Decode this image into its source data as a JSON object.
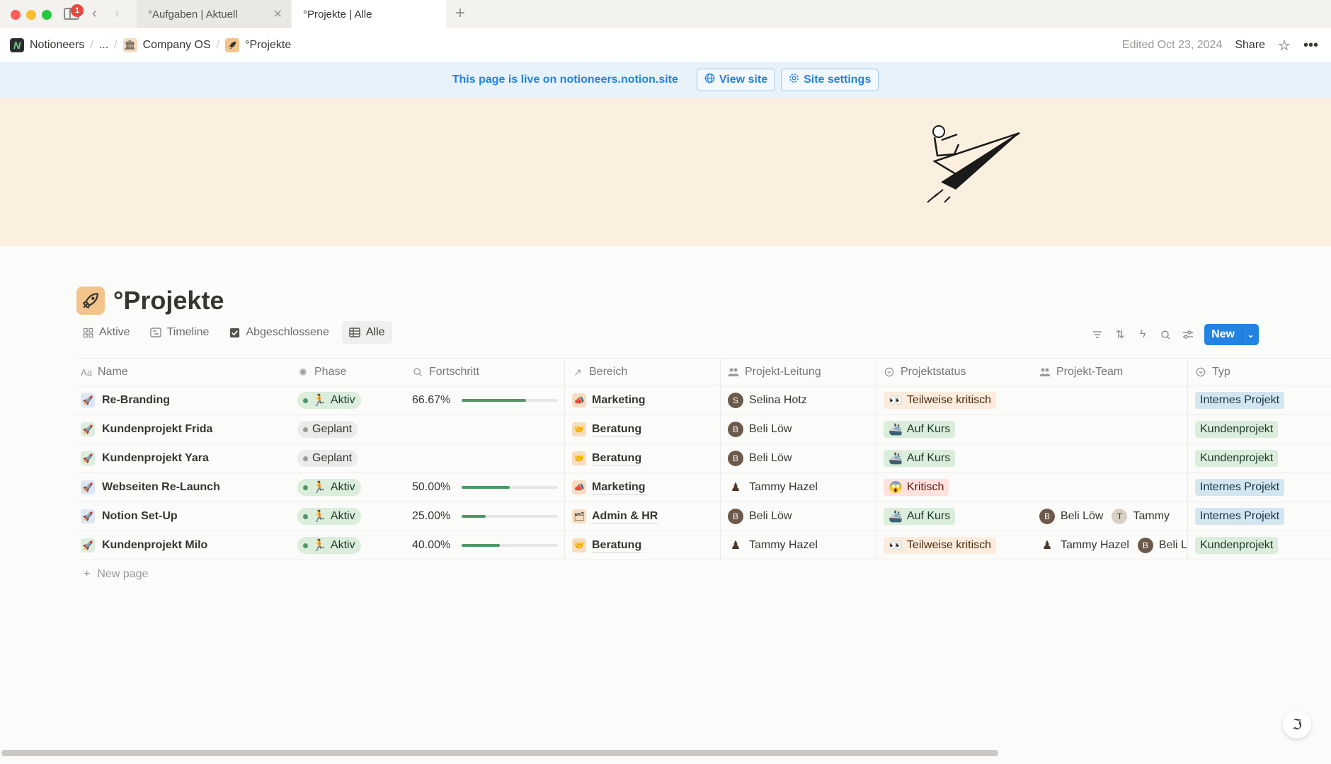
{
  "browser": {
    "notification_count": "1",
    "tabs": [
      {
        "label": "°Aufgaben | Aktuell"
      },
      {
        "label": "°Projekte | Alle"
      }
    ],
    "new_tab_label": "+"
  },
  "topbar": {
    "workspace": "Notioneers",
    "ellipsis": "...",
    "crumb_company": "Company OS",
    "crumb_projects": "°Projekte",
    "edited": "Edited Oct 23, 2024",
    "share": "Share"
  },
  "banner": {
    "text": "This page is live on notioneers.notion.site",
    "view_site": "View site",
    "site_settings": "Site settings"
  },
  "page": {
    "title": "°Projekte",
    "views": [
      {
        "label": "Aktive",
        "icon": "grid-icon"
      },
      {
        "label": "Timeline",
        "icon": "timeline-icon"
      },
      {
        "label": "Abgeschlossene",
        "icon": "checkbox-icon"
      },
      {
        "label": "Alle",
        "icon": "table-icon"
      }
    ],
    "new_button": "New",
    "new_page": "New page"
  },
  "table": {
    "columns": [
      "Name",
      "Phase",
      "Fortschritt",
      "Bereich",
      "Projekt-Leitung",
      "Projektstatus",
      "Projekt-Team",
      "Typ"
    ],
    "rows": [
      {
        "name": "Re-Branding",
        "phase": "Aktiv",
        "progress_text": "66.67%",
        "progress": 0.6667,
        "bereich": "Marketing",
        "lead": "Selina Hotz",
        "status": "Teilweise kritisch",
        "team": [],
        "typ": "Internes Projekt"
      },
      {
        "name": "Kundenprojekt Frida",
        "phase": "Geplant",
        "progress_text": "",
        "progress": 0,
        "bereich": "Beratung",
        "lead": "Beli Löw",
        "status": "Auf Kurs",
        "team": [],
        "typ": "Kundenprojekt"
      },
      {
        "name": "Kundenprojekt Yara",
        "phase": "Geplant",
        "progress_text": "",
        "progress": 0,
        "bereich": "Beratung",
        "lead": "Beli Löw",
        "status": "Auf Kurs",
        "team": [],
        "typ": "Kundenprojekt"
      },
      {
        "name": "Webseiten Re-Launch",
        "phase": "Aktiv",
        "progress_text": "50.00%",
        "progress": 0.5,
        "bereich": "Marketing",
        "lead": "Tammy Hazel",
        "status": "Kritisch",
        "team": [],
        "typ": "Internes Projekt"
      },
      {
        "name": "Notion Set-Up",
        "phase": "Aktiv",
        "progress_text": "25.00%",
        "progress": 0.25,
        "bereich": "Admin & HR",
        "lead": "Beli Löw",
        "status": "Auf Kurs",
        "team": [
          "Beli Löw",
          "Tammy"
        ],
        "typ": "Internes Projekt"
      },
      {
        "name": "Kundenprojekt Milo",
        "phase": "Aktiv",
        "progress_text": "40.00%",
        "progress": 0.4,
        "bereich": "Beratung",
        "lead": "Tammy Hazel",
        "status": "Teilweise kritisch",
        "team": [
          "Tammy Hazel",
          "Beli Löw"
        ],
        "typ": "Kundenprojekt"
      }
    ]
  },
  "colors": {
    "accent": "#2383e2",
    "cover": "#fbefdf",
    "progress": "#4f9768",
    "banner_bg": "#e8f2fb"
  }
}
